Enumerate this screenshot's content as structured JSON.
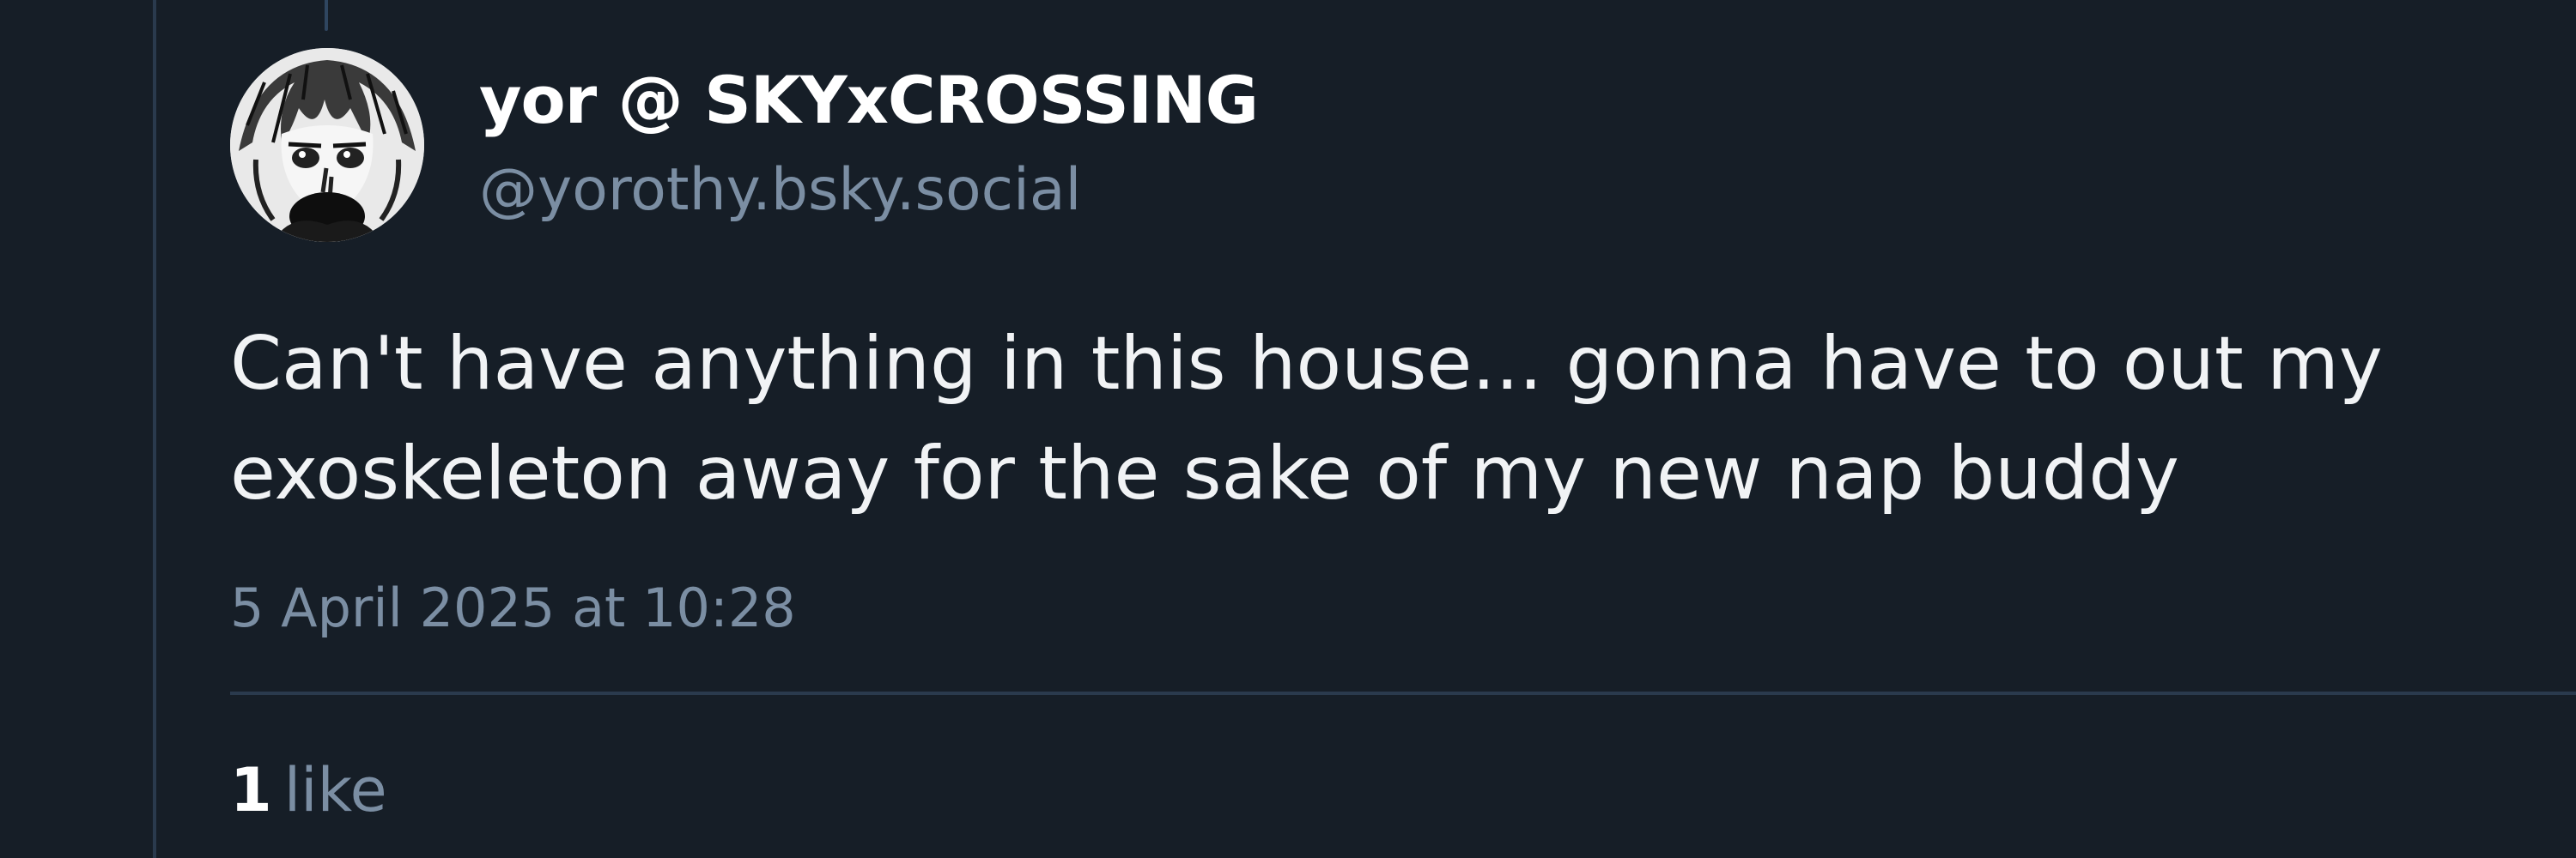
{
  "post": {
    "author": {
      "display_name": "yor @ SKYxCROSSING",
      "handle": "@yorothy.bsky.social",
      "avatar_icon": "manga-character-avatar"
    },
    "text": "Can't have anything in this house... gonna have to out my\nexoskeleton away for the sake of my new nap buddy",
    "timestamp": "5 April 2025 at 10:28",
    "likes": {
      "count": "1",
      "label": "like"
    }
  },
  "colors": {
    "background": "#161e27",
    "primary_text": "#f1f3f5",
    "secondary_text": "#7b8ea3",
    "border": "#2a3a4d"
  }
}
